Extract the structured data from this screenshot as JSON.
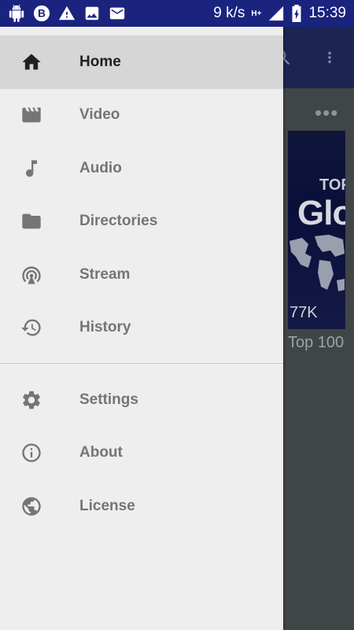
{
  "status_bar": {
    "speed": "9 k/s",
    "network": "H+",
    "time": "15:39",
    "left_icons": [
      "android-icon",
      "b-badge-icon",
      "warning-icon",
      "image-icon",
      "mail-icon"
    ]
  },
  "background": {
    "thumb_title_small": "TOP",
    "thumb_title_large": "Glo",
    "views": "77K",
    "caption": "Top 100"
  },
  "drawer": {
    "primary_items": [
      {
        "label": "Home",
        "icon": "home-icon",
        "active": true
      },
      {
        "label": "Video",
        "icon": "video-icon",
        "active": false
      },
      {
        "label": "Audio",
        "icon": "audio-icon",
        "active": false
      },
      {
        "label": "Directories",
        "icon": "folder-icon",
        "active": false
      },
      {
        "label": "Stream",
        "icon": "stream-icon",
        "active": false
      },
      {
        "label": "History",
        "icon": "history-icon",
        "active": false
      }
    ],
    "secondary_items": [
      {
        "label": "Settings",
        "icon": "settings-icon"
      },
      {
        "label": "About",
        "icon": "info-icon"
      },
      {
        "label": "License",
        "icon": "globe-icon"
      }
    ]
  },
  "colors": {
    "status_bar": "#1a237e",
    "drawer_bg": "#eeeeee",
    "active_bg": "#d6d6d6",
    "active_text": "#212121",
    "inactive_text": "#757575"
  }
}
